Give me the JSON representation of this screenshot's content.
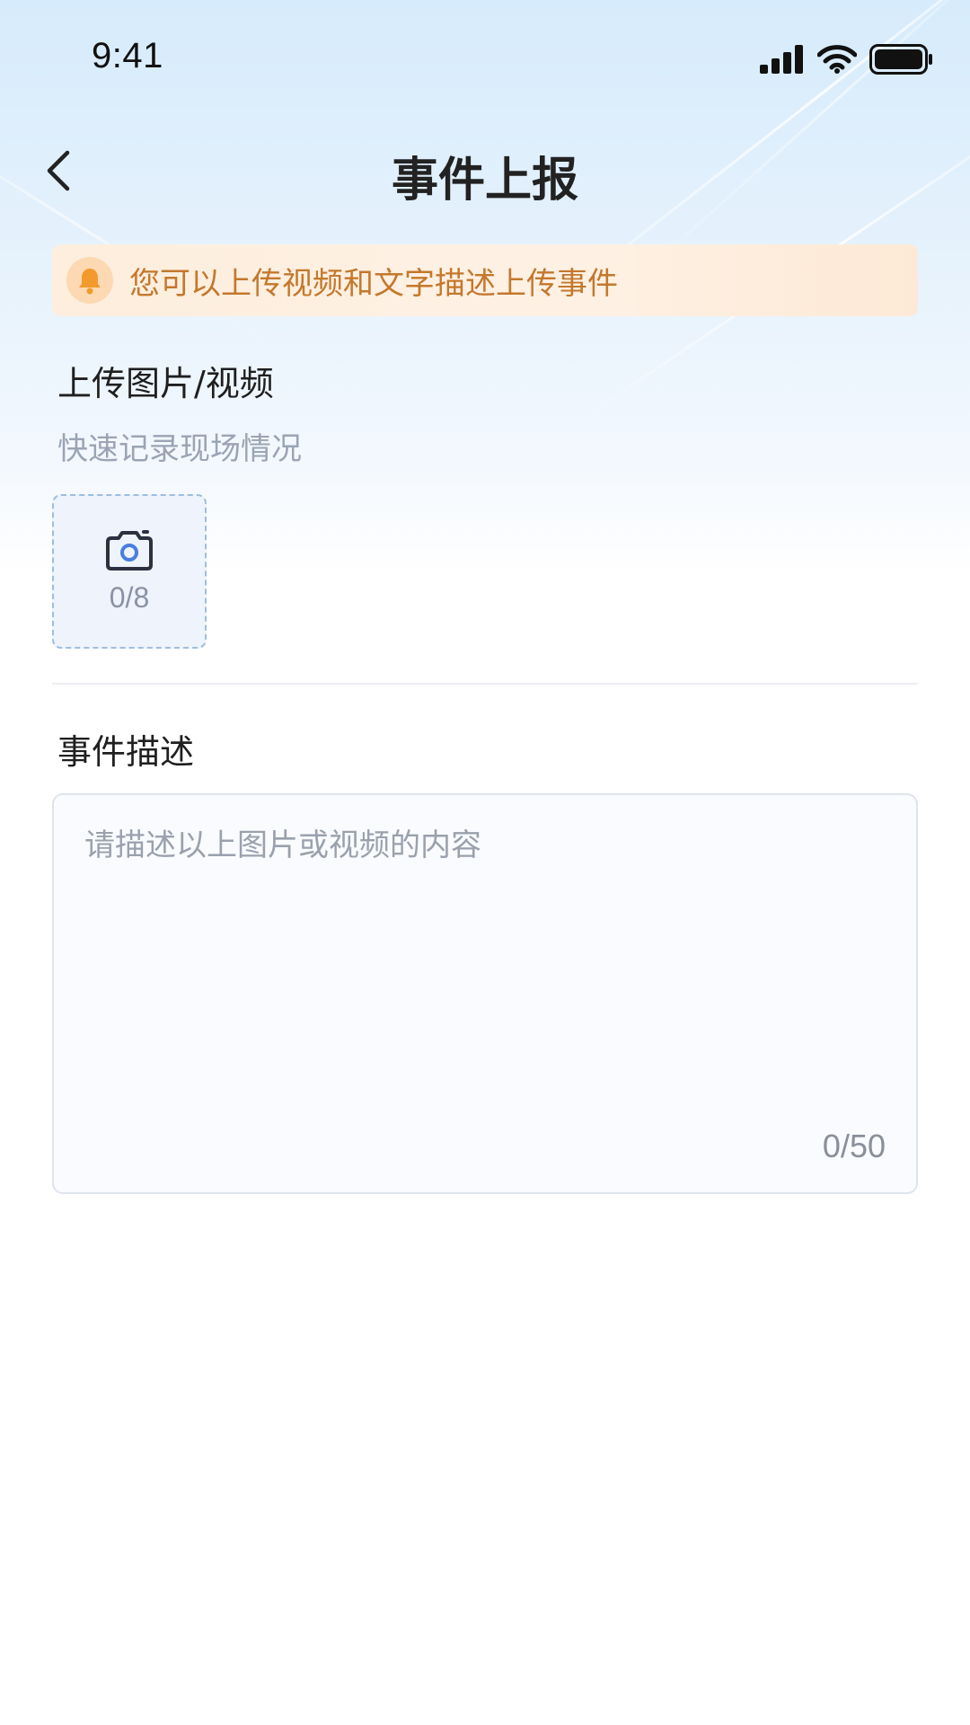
{
  "status_bar": {
    "time": "9:41"
  },
  "header": {
    "title": "事件上报"
  },
  "notice": {
    "text": "您可以上传视频和文字描述上传事件"
  },
  "upload": {
    "title": "上传图片/视频",
    "subtitle": "快速记录现场情况",
    "count": "0/8"
  },
  "description": {
    "title": "事件描述",
    "placeholder": "请描述以上图片或视频的内容",
    "count": "0/50"
  },
  "colors": {
    "notice_text": "#c4782c",
    "notice_icon": "#f39a2c",
    "uploader_border": "#9ebde0",
    "camera_lens": "#4a7ee0"
  }
}
